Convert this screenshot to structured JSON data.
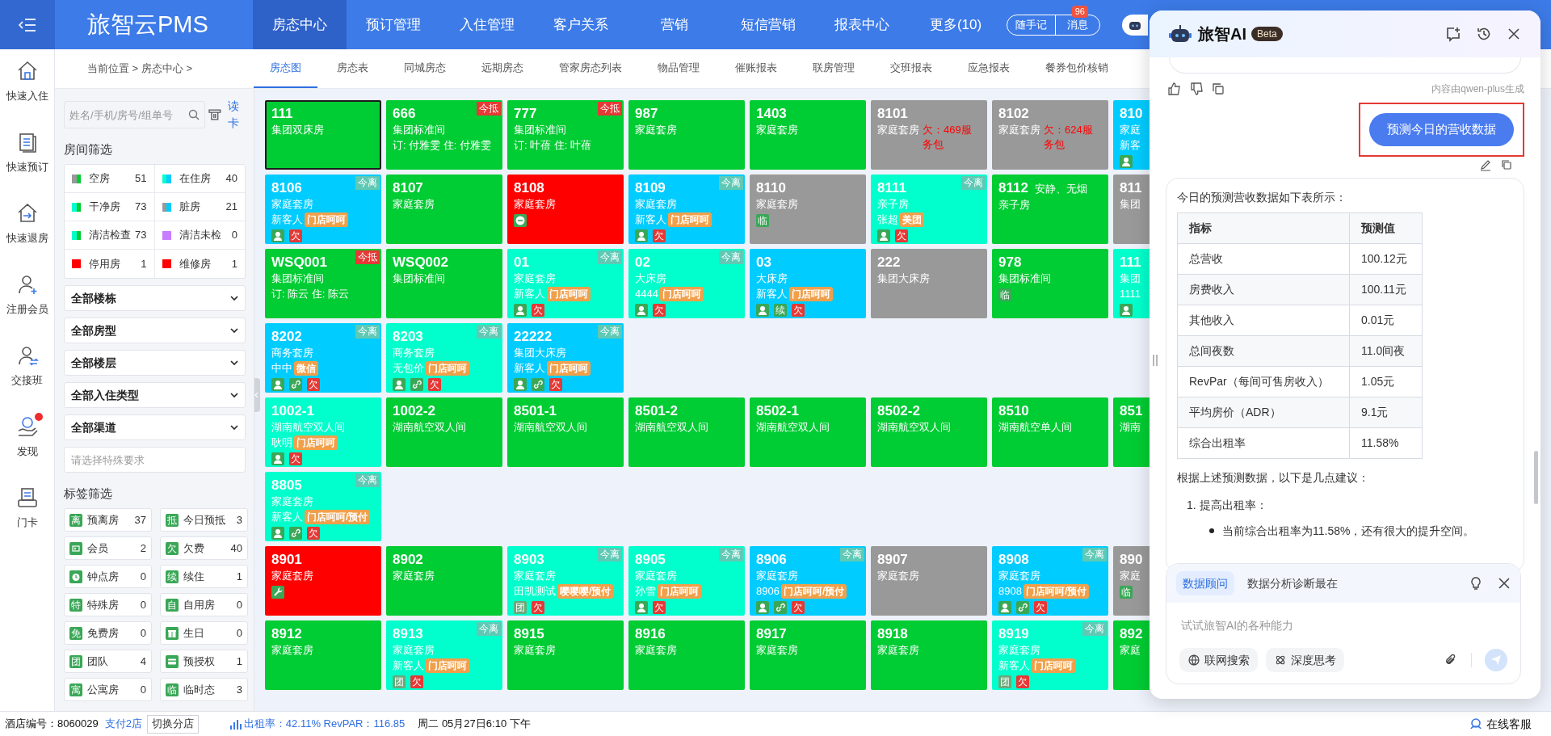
{
  "nav": {
    "logo": "旅智云PMS",
    "items": [
      {
        "label": "房态中心",
        "selected": true
      },
      {
        "label": "预订管理",
        "selected": false
      },
      {
        "label": "入住管理",
        "selected": false
      },
      {
        "label": "客户关系",
        "selected": false
      },
      {
        "label": "营销",
        "selected": false
      },
      {
        "label": "短信营销",
        "selected": false
      },
      {
        "label": "报表中心",
        "selected": false
      },
      {
        "label": "更多(10)",
        "selected": false
      }
    ],
    "memo": "随手记",
    "messages": "消息",
    "message_count": "96"
  },
  "subnav": {
    "breadcrumb": "当前位置 > 房态中心 >",
    "tabs": [
      {
        "label": "房态图",
        "selected": true
      },
      {
        "label": "房态表",
        "selected": false
      },
      {
        "label": "同城房态",
        "selected": false
      },
      {
        "label": "远期房态",
        "selected": false
      },
      {
        "label": "管家房态列表",
        "selected": false
      },
      {
        "label": "物品管理",
        "selected": false
      },
      {
        "label": "催账报表",
        "selected": false
      },
      {
        "label": "联房管理",
        "selected": false
      },
      {
        "label": "交班报表",
        "selected": false
      },
      {
        "label": "应急报表",
        "selected": false
      },
      {
        "label": "餐券包价核销",
        "selected": false
      }
    ]
  },
  "rail": [
    {
      "label": "快速入住",
      "alert": false
    },
    {
      "label": "快速预订",
      "alert": false
    },
    {
      "label": "快速退房",
      "alert": false
    },
    {
      "label": "注册会员",
      "alert": false
    },
    {
      "label": "交接班",
      "alert": false
    },
    {
      "label": "发现",
      "alert": true
    },
    {
      "label": "门卡",
      "alert": false
    }
  ],
  "search": {
    "placeholder": "姓名/手机/房号/组单号",
    "read_card": "读卡"
  },
  "room_filter": {
    "title": "房间筛选",
    "items": [
      {
        "label": "空房",
        "count": "51",
        "swatches": [
          {
            "color": "#999999"
          },
          {
            "color": "#00cc33"
          }
        ]
      },
      {
        "label": "在住房",
        "count": "40",
        "swatches": [
          {
            "color": "#00ffcc"
          },
          {
            "color": "#00ccff"
          }
        ]
      },
      {
        "label": "干净房",
        "count": "73",
        "swatches": [
          {
            "color": "#00ffcc"
          },
          {
            "color": "#00cc33"
          }
        ]
      },
      {
        "label": "脏房",
        "count": "21",
        "swatches": [
          {
            "color": "#999999"
          },
          {
            "color": "#00ccff"
          }
        ]
      },
      {
        "label": "清洁检查",
        "count": "73",
        "swatches": [
          {
            "color": "#00ffcc"
          },
          {
            "color": "#00cc33"
          }
        ]
      },
      {
        "label": "清洁未检",
        "count": "0",
        "swatches": [
          {
            "color": "#c77dff"
          }
        ]
      },
      {
        "label": "停用房",
        "count": "1",
        "swatches": [
          {
            "color": "#ff0000"
          }
        ]
      },
      {
        "label": "维修房",
        "count": "1",
        "swatches": [
          {
            "color": "#ff0000"
          }
        ]
      }
    ]
  },
  "selects": [
    "全部楼栋",
    "全部房型",
    "全部楼层",
    "全部入住类型",
    "全部渠道"
  ],
  "special": {
    "placeholder": "请选择特殊要求"
  },
  "tag_filter": {
    "title": "标签筛选",
    "items": [
      {
        "label": "预离房",
        "count": "37",
        "icon": {
          "kind": "char",
          "text": "离"
        }
      },
      {
        "label": "今日预抵",
        "count": "3",
        "icon": {
          "kind": "char",
          "text": "抵"
        }
      },
      {
        "label": "会员",
        "count": "2",
        "icon": {
          "kind": "member"
        }
      },
      {
        "label": "欠费",
        "count": "40",
        "icon": {
          "kind": "char",
          "text": "欠"
        }
      },
      {
        "label": "钟点房",
        "count": "0",
        "icon": {
          "kind": "clock"
        }
      },
      {
        "label": "续住",
        "count": "1",
        "icon": {
          "kind": "char",
          "text": "续"
        }
      },
      {
        "label": "特殊房",
        "count": "0",
        "icon": {
          "kind": "char",
          "text": "特"
        }
      },
      {
        "label": "自用房",
        "count": "0",
        "icon": {
          "kind": "char",
          "text": "自"
        }
      },
      {
        "label": "免费房",
        "count": "0",
        "icon": {
          "kind": "char",
          "text": "免"
        }
      },
      {
        "label": "生日",
        "count": "0",
        "icon": {
          "kind": "gift"
        }
      },
      {
        "label": "团队",
        "count": "4",
        "icon": {
          "kind": "char",
          "text": "团"
        }
      },
      {
        "label": "预授权",
        "count": "1",
        "icon": {
          "kind": "card"
        }
      },
      {
        "label": "公寓房",
        "count": "0",
        "icon": {
          "kind": "char",
          "text": "寓"
        }
      },
      {
        "label": "临时态",
        "count": "3",
        "icon": {
          "kind": "char",
          "text": "临"
        }
      }
    ]
  },
  "rooms": [
    [
      {
        "number": "111",
        "type": "集团双床房",
        "color": "#00cc33",
        "selected": true
      },
      {
        "number": "666",
        "type": "集团标准间",
        "booking": "订: 付雅雯 住: 付雅雯",
        "color": "#00cc33",
        "selected": false,
        "badge": {
          "kind": "arrive",
          "text": "今抵"
        }
      },
      {
        "number": "777",
        "type": "集团标准间",
        "booking": "订: 叶蓓 住: 叶蓓",
        "color": "#00cc33",
        "selected": false,
        "badge": {
          "kind": "arrive",
          "text": "今抵"
        }
      },
      {
        "number": "987",
        "type": "家庭套房",
        "color": "#00cc33",
        "selected": false
      },
      {
        "number": "1403",
        "type": "家庭套房",
        "color": "#00cc33",
        "selected": false
      },
      {
        "number": "8101",
        "type": "家庭套房",
        "note": "欠：469服务包",
        "color": "#999999",
        "selected": false
      },
      {
        "number": "8102",
        "type": "家庭套房",
        "note": "欠：624服务包",
        "color": "#999999",
        "selected": false
      },
      {
        "number": "810",
        "type": "家庭",
        "guest": "新客",
        "color": "#00ccff",
        "selected": false,
        "marks": [
          {
            "kind": "person"
          }
        ]
      }
    ],
    [
      {
        "number": "8106",
        "type": "家庭套房",
        "guest": "新客人",
        "tag": "门店呵呵",
        "color": "#00ccff",
        "selected": false,
        "badge": {
          "kind": "leave",
          "text": "今离"
        },
        "marks": [
          {
            "kind": "person"
          },
          {
            "kind": "text",
            "text": "欠",
            "color": "#e53935"
          }
        ]
      },
      {
        "number": "8107",
        "type": "家庭套房",
        "color": "#00cc33",
        "selected": false
      },
      {
        "number": "8108",
        "type": "家庭套房",
        "color": "#ff0000",
        "selected": false,
        "marks": [
          {
            "kind": "stop"
          }
        ]
      },
      {
        "number": "8109",
        "type": "家庭套房",
        "guest": "新客人",
        "tag": "门店呵呵",
        "color": "#00ccff",
        "selected": false,
        "badge": {
          "kind": "leave",
          "text": "今离"
        },
        "marks": [
          {
            "kind": "person"
          },
          {
            "kind": "text",
            "text": "欠",
            "color": "#e53935"
          }
        ]
      },
      {
        "number": "8110",
        "type": "家庭套房",
        "color": "#999999",
        "selected": false,
        "marks": [
          {
            "kind": "text",
            "text": "临",
            "color": "#3aa757"
          }
        ]
      },
      {
        "number": "8111",
        "type": "亲子房",
        "guest": "张超",
        "tag": "美团",
        "color": "#00ffcc",
        "selected": false,
        "badge": {
          "kind": "leave",
          "text": "今离"
        },
        "marks": [
          {
            "kind": "person"
          },
          {
            "kind": "text",
            "text": "欠",
            "color": "#e53935"
          }
        ]
      },
      {
        "number": "8112",
        "remark": "安静、无烟",
        "type": "亲子房",
        "color": "#00cc33",
        "selected": false
      },
      {
        "number": "811",
        "type": "集团",
        "color": "#999999",
        "selected": false
      }
    ],
    [
      {
        "number": "WSQ001",
        "type": "集团标准间",
        "booking": "订: 陈云 住: 陈云",
        "color": "#00cc33",
        "selected": false,
        "badge": {
          "kind": "arrive",
          "text": "今抵"
        }
      },
      {
        "number": "WSQ002",
        "type": "集团标准间",
        "color": "#00cc33",
        "selected": false
      },
      {
        "number": "01",
        "type": "家庭套房",
        "guest": "新客人",
        "tag": "门店呵呵",
        "color": "#00ffcc",
        "selected": false,
        "badge": {
          "kind": "leave",
          "text": "今离"
        },
        "marks": [
          {
            "kind": "person"
          },
          {
            "kind": "text",
            "text": "欠",
            "color": "#e53935"
          }
        ]
      },
      {
        "number": "02",
        "type": "大床房",
        "guest": "4444",
        "tag": "门店呵呵",
        "color": "#00ffcc",
        "selected": false,
        "badge": {
          "kind": "leave",
          "text": "今离"
        },
        "marks": [
          {
            "kind": "person"
          },
          {
            "kind": "text",
            "text": "欠",
            "color": "#e53935"
          }
        ]
      },
      {
        "number": "03",
        "type": "大床房",
        "guest": "新客人",
        "tag": "门店呵呵",
        "color": "#00ccff",
        "selected": false,
        "marks": [
          {
            "kind": "person"
          },
          {
            "kind": "text",
            "text": "续",
            "color": "#3aa757"
          },
          {
            "kind": "text",
            "text": "欠",
            "color": "#e53935"
          }
        ]
      },
      {
        "number": "222",
        "type": "集团大床房",
        "color": "#999999",
        "selected": false
      },
      {
        "number": "978",
        "type": "集团标准间",
        "color": "#00cc33",
        "selected": false,
        "marks": [
          {
            "kind": "text",
            "text": "临",
            "color": "#3aa757"
          }
        ]
      },
      {
        "number": "111",
        "type": "集团",
        "guest": "1111",
        "color": "#00ffcc",
        "selected": false,
        "marks": [
          {
            "kind": "person"
          }
        ]
      }
    ],
    [
      {
        "number": "8202",
        "type": "商务套房",
        "guest": "中中",
        "tag": "微信",
        "color": "#00ccff",
        "selected": false,
        "badge": {
          "kind": "leave",
          "text": "今离"
        },
        "marks": [
          {
            "kind": "person"
          },
          {
            "kind": "link"
          },
          {
            "kind": "text",
            "text": "欠",
            "color": "#e53935"
          }
        ]
      },
      {
        "number": "8203",
        "type": "商务套房",
        "guest": "无包价",
        "tag": "门店呵呵",
        "color": "#00ffcc",
        "selected": false,
        "badge": {
          "kind": "leave",
          "text": "今离"
        },
        "marks": [
          {
            "kind": "person"
          },
          {
            "kind": "link"
          },
          {
            "kind": "text",
            "text": "欠",
            "color": "#e53935"
          }
        ]
      },
      {
        "number": "22222",
        "type": "集团大床房",
        "guest": "新客人",
        "tag": "门店呵呵",
        "color": "#00ccff",
        "selected": false,
        "badge": {
          "kind": "leave",
          "text": "今离"
        },
        "marks": [
          {
            "kind": "person"
          },
          {
            "kind": "link"
          },
          {
            "kind": "text",
            "text": "欠",
            "color": "#e53935"
          }
        ]
      }
    ],
    [
      {
        "number": "1002-1",
        "type": "湖南航空双人间",
        "guest": "耿明",
        "tag": "门店呵呵",
        "color": "#00ffcc",
        "selected": false,
        "marks": [
          {
            "kind": "person"
          },
          {
            "kind": "text",
            "text": "欠",
            "color": "#e53935"
          }
        ]
      },
      {
        "number": "1002-2",
        "type": "湖南航空双人间",
        "color": "#00cc33",
        "selected": false
      },
      {
        "number": "8501-1",
        "type": "湖南航空双人间",
        "color": "#00cc33",
        "selected": false
      },
      {
        "number": "8501-2",
        "type": "湖南航空双人间",
        "color": "#00cc33",
        "selected": false
      },
      {
        "number": "8502-1",
        "type": "湖南航空双人间",
        "color": "#00cc33",
        "selected": false
      },
      {
        "number": "8502-2",
        "type": "湖南航空双人间",
        "color": "#00cc33",
        "selected": false
      },
      {
        "number": "8510",
        "type": "湖南航空单人间",
        "color": "#00cc33",
        "selected": false
      },
      {
        "number": "851",
        "type": "湖南",
        "color": "#00cc33",
        "selected": false
      }
    ],
    [
      {
        "number": "8805",
        "type": "家庭套房",
        "guest": "新客人",
        "tag": "门店呵呵/预付",
        "color": "#00ffcc",
        "selected": false,
        "badge": {
          "kind": "leave",
          "text": "今离"
        },
        "marks": [
          {
            "kind": "person"
          },
          {
            "kind": "link"
          },
          {
            "kind": "text",
            "text": "欠",
            "color": "#e53935"
          }
        ]
      }
    ],
    [
      {
        "number": "8901",
        "type": "家庭套房",
        "color": "#ff0000",
        "selected": false,
        "marks": [
          {
            "kind": "wrench"
          }
        ]
      },
      {
        "number": "8902",
        "type": "家庭套房",
        "color": "#00cc33",
        "selected": false
      },
      {
        "number": "8903",
        "type": "家庭套房",
        "guest": "田凯测试",
        "tag": "嘤嘤嘤/预付",
        "color": "#00ffcc",
        "selected": false,
        "badge": {
          "kind": "leave",
          "text": "今离"
        },
        "marks": [
          {
            "kind": "text",
            "text": "团",
            "color": "#6aa87a"
          },
          {
            "kind": "text",
            "text": "欠",
            "color": "#e53935"
          }
        ]
      },
      {
        "number": "8905",
        "type": "家庭套房",
        "guest": "孙雪",
        "tag": "门店呵呵",
        "color": "#00ffcc",
        "selected": false,
        "badge": {
          "kind": "leave",
          "text": "今离"
        },
        "marks": [
          {
            "kind": "person"
          },
          {
            "kind": "text",
            "text": "欠",
            "color": "#e53935"
          }
        ]
      },
      {
        "number": "8906",
        "type": "家庭套房",
        "guest": "8906",
        "tag": "门店呵呵/预付",
        "color": "#00ccff",
        "selected": false,
        "badge": {
          "kind": "leave",
          "text": "今离"
        },
        "marks": [
          {
            "kind": "person"
          },
          {
            "kind": "link"
          },
          {
            "kind": "text",
            "text": "欠",
            "color": "#e53935"
          }
        ]
      },
      {
        "number": "8907",
        "type": "家庭套房",
        "color": "#999999",
        "selected": false
      },
      {
        "number": "8908",
        "type": "家庭套房",
        "guest": "8908",
        "tag": "门店呵呵/预付",
        "color": "#00ccff",
        "selected": false,
        "badge": {
          "kind": "leave",
          "text": "今离"
        },
        "marks": [
          {
            "kind": "person"
          },
          {
            "kind": "link"
          },
          {
            "kind": "text",
            "text": "欠",
            "color": "#e53935"
          }
        ]
      },
      {
        "number": "890",
        "type": "家庭",
        "color": "#999999",
        "selected": false,
        "marks": [
          {
            "kind": "text",
            "text": "临",
            "color": "#3aa757"
          }
        ]
      }
    ],
    [
      {
        "number": "8912",
        "type": "家庭套房",
        "color": "#00cc33",
        "selected": false
      },
      {
        "number": "8913",
        "type": "家庭套房",
        "guest": "新客人",
        "tag": "门店呵呵",
        "color": "#00ffcc",
        "selected": false,
        "badge": {
          "kind": "leave",
          "text": "今离"
        },
        "marks": [
          {
            "kind": "text",
            "text": "团",
            "color": "#6aa87a"
          },
          {
            "kind": "text",
            "text": "欠",
            "color": "#e53935"
          }
        ]
      },
      {
        "number": "8915",
        "type": "家庭套房",
        "color": "#00cc33",
        "selected": false
      },
      {
        "number": "8916",
        "type": "家庭套房",
        "color": "#00cc33",
        "selected": false
      },
      {
        "number": "8917",
        "type": "家庭套房",
        "color": "#00cc33",
        "selected": false
      },
      {
        "number": "8918",
        "type": "家庭套房",
        "color": "#00cc33",
        "selected": false
      },
      {
        "number": "8919",
        "type": "家庭套房",
        "guest": "新客人",
        "tag": "门店呵呵",
        "color": "#00ffcc",
        "selected": false,
        "badge": {
          "kind": "leave",
          "text": "今离"
        },
        "marks": [
          {
            "kind": "text",
            "text": "团",
            "color": "#6aa87a"
          },
          {
            "kind": "text",
            "text": "欠",
            "color": "#e53935"
          }
        ]
      },
      {
        "number": "892",
        "type": "家庭",
        "color": "#00cc33",
        "selected": false
      }
    ]
  ],
  "ai_panel": {
    "title": "旅智AI",
    "badge": "Beta",
    "generated_by": "内容由qwen-plus生成",
    "user_message": {
      "text": "预测今日的营收数据",
      "highlighted": true
    },
    "answer": {
      "intro": "今日的预测营收数据如下表所示：",
      "table": {
        "columns": [
          "指标",
          "预测值"
        ],
        "rows": [
          [
            "总营收",
            "100.12元"
          ],
          [
            "房费收入",
            "100.11元"
          ],
          [
            "其他收入",
            "0.01元"
          ],
          [
            "总间夜数",
            "11.0间夜"
          ],
          [
            "RevPar（每间可售房收入）",
            "1.05元"
          ],
          [
            "平均房价（ADR）",
            "9.1元"
          ],
          [
            "综合出租率",
            "11.58%"
          ]
        ]
      },
      "summary": "根据上述预测数据，以下是几点建议：",
      "list": [
        {
          "number": "1.",
          "title": "提高出租率：",
          "bullets": [
            "当前综合出租率为11.58%，还有很大的提升空间。"
          ]
        }
      ]
    },
    "composer": {
      "modes": [
        {
          "label": "数据顾问",
          "selected": true
        },
        {
          "label": "数据分析诊断最在",
          "selected": false
        }
      ],
      "placeholder": "试试旅智AI的各种能力",
      "tools": [
        "联网搜索",
        "深度思考"
      ]
    }
  },
  "status_bar": {
    "hotel": "酒店编号：8060029",
    "store": "支付2店",
    "switch": "切换分店",
    "occupancy": "出租率：42.11% RevPAR：116.85",
    "datetime": "周二 05月27日6:10 下午",
    "support": "在线客服"
  }
}
